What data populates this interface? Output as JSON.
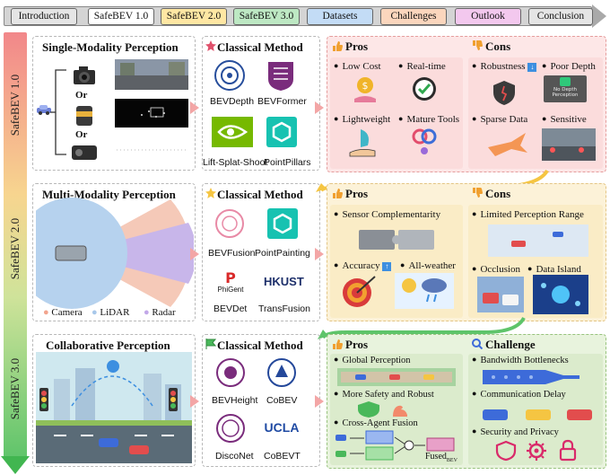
{
  "nav": {
    "items": [
      {
        "label": "Introduction",
        "color": "#e5e5e5"
      },
      {
        "label": "SafeBEV 1.0",
        "color": "#ffffff"
      },
      {
        "label": "SafeBEV 2.0",
        "color": "#ffe7a3"
      },
      {
        "label": "SafeBEV 3.0",
        "color": "#bde8c3"
      },
      {
        "label": "Datasets",
        "color": "#c3dcf6"
      },
      {
        "label": "Challenges",
        "color": "#fbd6bd"
      },
      {
        "label": "Outlook",
        "color": "#f3c8ee"
      },
      {
        "label": "Conclusion",
        "color": "#e5e5e5"
      }
    ]
  },
  "stages": [
    "SafeBEV 1.0",
    "SafeBEV 2.0",
    "SafeBEV 3.0"
  ],
  "row1": {
    "perception_title": "Single-Modality Perception",
    "or_labels": [
      "Or",
      "Or"
    ],
    "method_title": "Classical Method",
    "methods": [
      "BEVDepth",
      "BEVFormer",
      "Lift-Splat-Shoot",
      "PointPillars"
    ],
    "pros_title": "Pros",
    "pros": [
      "Low Cost",
      "Real-time",
      "Lightweight",
      "Mature Tools"
    ],
    "cons_title": "Cons",
    "cons": [
      "Robustness",
      "Poor Depth",
      "Sparse Data",
      "Sensitive"
    ],
    "no_depth_caption": "No Depth Perception"
  },
  "row2": {
    "perception_title": "Multi-Modality Perception",
    "legend": [
      "Camera",
      "LiDAR",
      "Radar"
    ],
    "method_title": "Classical Method",
    "methods": [
      "BEVFusion",
      "PointPainting",
      "BEVDet",
      "TransFusion"
    ],
    "logo_texts": {
      "phigent": "PhiGent",
      "hkust": "HKUST"
    },
    "pros_title": "Pros",
    "pros": [
      "Sensor Complementarity",
      "Accuracy",
      "All-weather"
    ],
    "cons_title": "Cons",
    "cons": [
      "Limited Perception Range",
      "Occlusion",
      "Data Island"
    ]
  },
  "row3": {
    "perception_title": "Collaborative Perception",
    "method_title": "Classical Method",
    "methods": [
      "BEVHeight",
      "CoBEV",
      "DiscoNet",
      "CoBEVT"
    ],
    "logo_texts": {
      "ucla": "UCLA"
    },
    "pros_title": "Pros",
    "pros": [
      "Global Perception",
      "More Safety and Robust",
      "Cross-Agent Fusion"
    ],
    "fused_label": "Fused",
    "fused_sub": "BEV",
    "challenge_title": "Challenge",
    "challenges": [
      "Bandwidth Bottlenecks",
      "Communication Delay",
      "Security and Privacy"
    ]
  }
}
